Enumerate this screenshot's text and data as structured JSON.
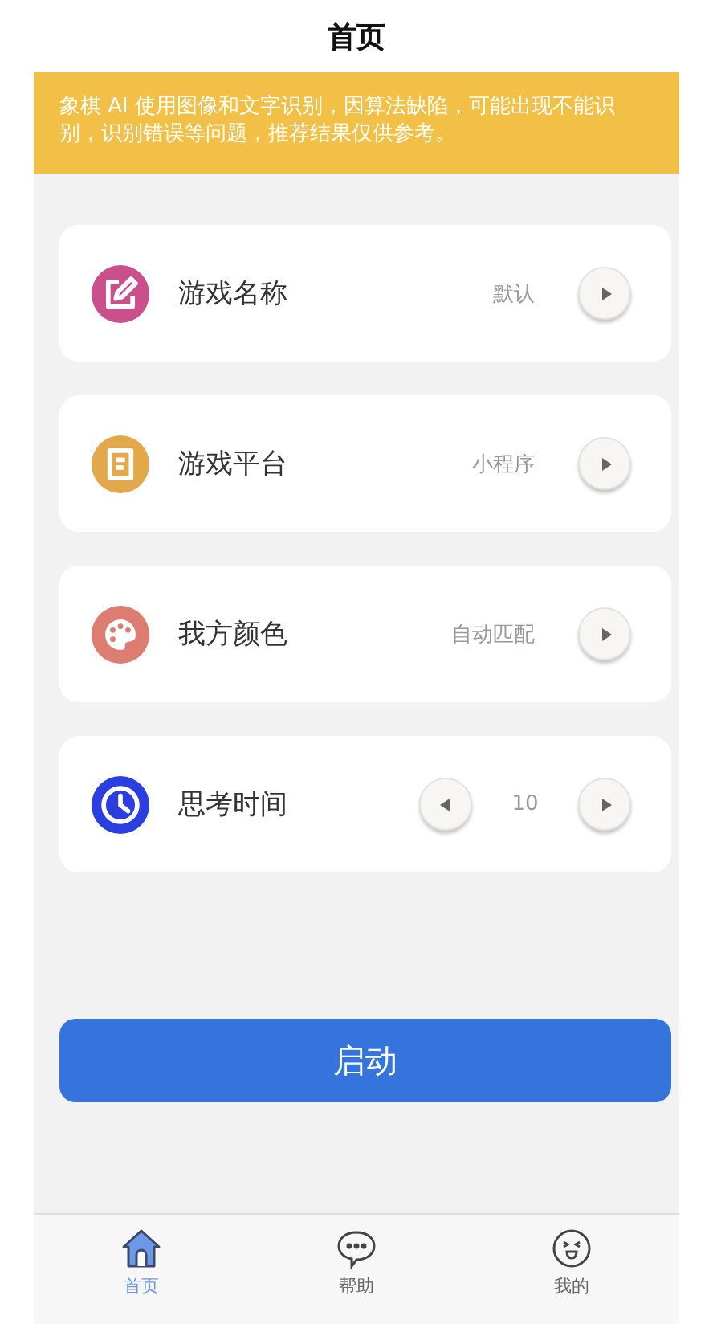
{
  "header": {
    "title": "首页"
  },
  "notice": "象棋 AI 使用图像和文字识别，因算法缺陷，可能出现不能识别，识别错误等问题，推荐结果仅供参考。",
  "settings": [
    {
      "kind": "select",
      "color": "#c9508a",
      "label": "游戏名称",
      "value": "默认"
    },
    {
      "kind": "select",
      "color": "#e3a84a",
      "label": "游戏平台",
      "value": "小程序"
    },
    {
      "kind": "select",
      "color": "#dd7d72",
      "label": "我方颜色",
      "value": "自动匹配"
    },
    {
      "kind": "stepper",
      "color": "#2b3fe0",
      "label": "思考时间",
      "value": "10"
    }
  ],
  "start_button": "启动",
  "tabs": [
    {
      "label": "首页",
      "selected": true
    },
    {
      "label": "帮助",
      "selected": false
    },
    {
      "label": "我的",
      "selected": false
    }
  ]
}
